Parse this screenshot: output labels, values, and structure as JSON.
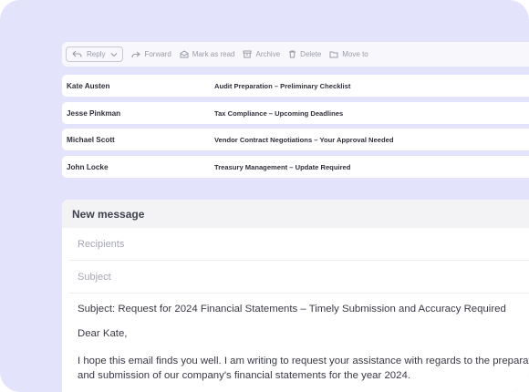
{
  "toolbar": {
    "reply": "Reply",
    "forward": "Forward",
    "mark_as_read": "Mark as read",
    "archive": "Archive",
    "delete": "Delete",
    "move_to": "Move to"
  },
  "emails": [
    {
      "sender": "Kate Austen",
      "subject": "Audit Preparation – Preliminary Checklist"
    },
    {
      "sender": "Jesse Pinkman",
      "subject": "Tax Compliance – Upcoming Deadlines"
    },
    {
      "sender": "Michael Scott",
      "subject": "Vendor Contract Negotiations – Your Approval Needed"
    },
    {
      "sender": "John Locke",
      "subject": "Treasury Management – Update Required"
    }
  ],
  "compose": {
    "title": "New message",
    "recipients_placeholder": "Recipients",
    "subject_placeholder": "Subject",
    "body_subject_line": "Subject: Request for 2024 Financial Statements – Timely Submission and Accuracy Required",
    "greeting": "Dear Kate,",
    "paragraph_line1": "I hope this email finds you well. I am writing to request your assistance with regards to the preparation",
    "paragraph_line2": "and submission of our company's financial statements for the year 2024."
  },
  "colors": {
    "background": "#e3e3fb",
    "toolbar_text": "#9a9aa8",
    "text": "#2f2f3a"
  }
}
